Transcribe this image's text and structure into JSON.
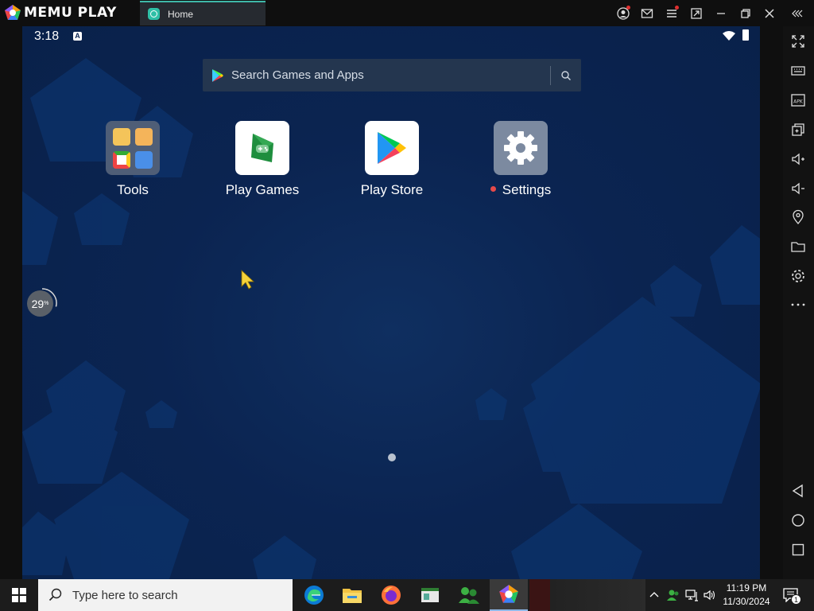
{
  "titlebar": {
    "brand": "MEMU PLAY",
    "tab_label": "Home",
    "icons": [
      "account-icon",
      "mail-icon",
      "menu-icon",
      "screenshot-icon",
      "minimize-icon",
      "restore-icon",
      "close-icon",
      "collapse-panel-icon"
    ]
  },
  "android": {
    "status": {
      "time": "3:18",
      "notification_badge": "A"
    },
    "search": {
      "placeholder": "Search Games and Apps"
    },
    "apps": [
      {
        "label": "Tools"
      },
      {
        "label": "Play Games"
      },
      {
        "label": "Play Store"
      },
      {
        "label": "Settings",
        "has_notification_dot": true
      }
    ],
    "page_indicator": {
      "pages": 1,
      "current": 1
    }
  },
  "perf_widget": {
    "value": "29",
    "unit": "%",
    "ring_fraction": 0.29
  },
  "right_panel": {
    "buttons": [
      "fullscreen-icon",
      "keyboard-icon",
      "apk-icon",
      "multi-instance-icon",
      "volume-up-icon",
      "volume-down-icon",
      "location-icon",
      "folder-icon",
      "settings-icon",
      "more-icon",
      "back-icon",
      "home-icon",
      "recents-icon"
    ]
  },
  "taskbar": {
    "search_placeholder": "Type here to search",
    "apps": [
      "edge-icon",
      "file-explorer-icon",
      "firefox-icon",
      "app-window-icon",
      "people-app-icon",
      "memu-icon"
    ],
    "clock_time": "11:19 PM",
    "clock_date": "11/30/2024",
    "notification_count": "1"
  },
  "colors": {
    "accent": "#3fb8a8",
    "wallpaper": "#0b2451",
    "settings_dot": "#e64a4a"
  }
}
